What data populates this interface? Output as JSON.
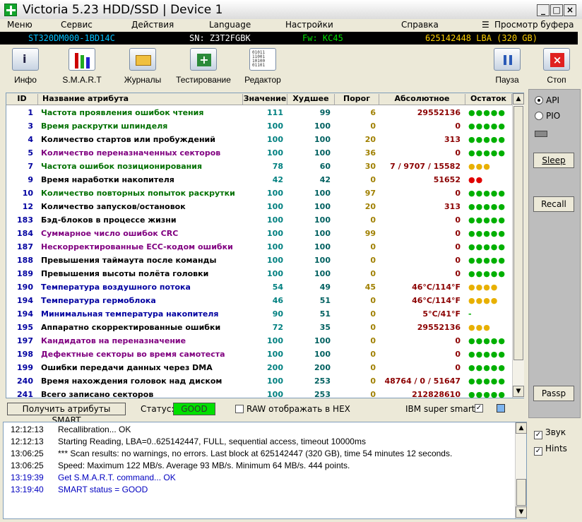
{
  "window": {
    "title": "Victoria 5.23 HDD/SSD | Device 1"
  },
  "menu": {
    "items": [
      "Меню",
      "Сервис",
      "Действия",
      "Language",
      "Настройки",
      "Справка"
    ],
    "buffer_view": "Просмотр буфера"
  },
  "device": {
    "model": "ST320DM000-1BD14C",
    "serial": "SN: Z3T2FGBK",
    "firmware": "Fw: KC45",
    "capacity": "625142448 LBA (320 GB)"
  },
  "toolbar": {
    "info": "Инфо",
    "smart": "S.M.A.R.T",
    "logs": "Журналы",
    "testing": "Тестирование",
    "editor": "Редактор",
    "pause": "Пауза",
    "stop": "Стоп"
  },
  "smart": {
    "columns": [
      "ID",
      "Название атрибута",
      "Значение",
      "Худшее",
      "Порог",
      "Абсолютное",
      "Остаток"
    ],
    "rows": [
      {
        "id": "1",
        "name": "Частота проявления ошибок чтения",
        "value": "111",
        "worst": "99",
        "threshold": "6",
        "raw": "29552136",
        "dots": "●●●●●",
        "name_color": "#007000",
        "dot_color": "#00b000"
      },
      {
        "id": "3",
        "name": "Время раскрутки шпинделя",
        "value": "100",
        "worst": "100",
        "threshold": "0",
        "raw": "0",
        "dots": "●●●●●",
        "name_color": "#007000",
        "dot_color": "#00b000"
      },
      {
        "id": "4",
        "name": "Количество стартов или пробуждений",
        "value": "100",
        "worst": "100",
        "threshold": "20",
        "raw": "313",
        "dots": "●●●●●",
        "name_color": "#000000",
        "dot_color": "#00b000"
      },
      {
        "id": "5",
        "name": "Количество переназначенных секторов",
        "value": "100",
        "worst": "100",
        "threshold": "36",
        "raw": "0",
        "dots": "●●●●●",
        "name_color": "#800080",
        "dot_color": "#00b000"
      },
      {
        "id": "7",
        "name": "Частота ошибок позиционирования",
        "value": "78",
        "worst": "60",
        "threshold": "30",
        "raw": "7 / 9707 / 15582",
        "dots": "●●●",
        "name_color": "#007000",
        "dot_color": "#e8b000"
      },
      {
        "id": "9",
        "name": "Время наработки накопителя",
        "value": "42",
        "worst": "42",
        "threshold": "0",
        "raw": "51652",
        "dots": "●●",
        "name_color": "#000000",
        "dot_color": "#e00000"
      },
      {
        "id": "10",
        "name": "Количество повторных попыток раскрутки",
        "value": "100",
        "worst": "100",
        "threshold": "97",
        "raw": "0",
        "dots": "●●●●●",
        "name_color": "#007000",
        "dot_color": "#00b000"
      },
      {
        "id": "12",
        "name": "Количество запусков/остановок",
        "value": "100",
        "worst": "100",
        "threshold": "20",
        "raw": "313",
        "dots": "●●●●●",
        "name_color": "#000000",
        "dot_color": "#00b000"
      },
      {
        "id": "183",
        "name": "Бэд-блоков в процессе жизни",
        "value": "100",
        "worst": "100",
        "threshold": "0",
        "raw": "0",
        "dots": "●●●●●",
        "name_color": "#000000",
        "dot_color": "#00b000"
      },
      {
        "id": "184",
        "name": "Суммарное число ошибок CRC",
        "value": "100",
        "worst": "100",
        "threshold": "99",
        "raw": "0",
        "dots": "●●●●●",
        "name_color": "#800080",
        "dot_color": "#00b000"
      },
      {
        "id": "187",
        "name": "Нескорректированные ECC-кодом ошибки",
        "value": "100",
        "worst": "100",
        "threshold": "0",
        "raw": "0",
        "dots": "●●●●●",
        "name_color": "#800080",
        "dot_color": "#00b000"
      },
      {
        "id": "188",
        "name": "Превышения таймаута после команды",
        "value": "100",
        "worst": "100",
        "threshold": "0",
        "raw": "0",
        "dots": "●●●●●",
        "name_color": "#000000",
        "dot_color": "#00b000"
      },
      {
        "id": "189",
        "name": "Превышения высоты полёта головки",
        "value": "100",
        "worst": "100",
        "threshold": "0",
        "raw": "0",
        "dots": "●●●●●",
        "name_color": "#000000",
        "dot_color": "#00b000"
      },
      {
        "id": "190",
        "name": "Температура воздушного потока",
        "value": "54",
        "worst": "49",
        "threshold": "45",
        "raw": "46°C/114°F",
        "dots": "●●●●",
        "name_color": "#0000a0",
        "dot_color": "#e8b000"
      },
      {
        "id": "194",
        "name": "Температура гермоблока",
        "value": "46",
        "worst": "51",
        "threshold": "0",
        "raw": "46°C/114°F",
        "dots": "●●●●",
        "name_color": "#0000a0",
        "dot_color": "#e8b000"
      },
      {
        "id": "194",
        "name": "Минимальная температура накопителя",
        "value": "90",
        "worst": "51",
        "threshold": "0",
        "raw": "5°C/41°F",
        "dots": "-",
        "name_color": "#0000a0",
        "dot_color": "#00b000"
      },
      {
        "id": "195",
        "name": "Аппаратно скорректированные ошибки",
        "value": "72",
        "worst": "35",
        "threshold": "0",
        "raw": "29552136",
        "dots": "●●●",
        "name_color": "#000000",
        "dot_color": "#e8b000"
      },
      {
        "id": "197",
        "name": "Кандидатов на переназначение",
        "value": "100",
        "worst": "100",
        "threshold": "0",
        "raw": "0",
        "dots": "●●●●●",
        "name_color": "#800080",
        "dot_color": "#00b000"
      },
      {
        "id": "198",
        "name": "Дефектные секторы во время самотеста",
        "value": "100",
        "worst": "100",
        "threshold": "0",
        "raw": "0",
        "dots": "●●●●●",
        "name_color": "#800080",
        "dot_color": "#00b000"
      },
      {
        "id": "199",
        "name": "Ошибки передачи данных через DMA",
        "value": "200",
        "worst": "200",
        "threshold": "0",
        "raw": "0",
        "dots": "●●●●●",
        "name_color": "#000000",
        "dot_color": "#00b000"
      },
      {
        "id": "240",
        "name": "Время нахождения головок над диском",
        "value": "100",
        "worst": "253",
        "threshold": "0",
        "raw": "48764 / 0 / 51647",
        "dots": "●●●●●",
        "name_color": "#000000",
        "dot_color": "#00b000"
      },
      {
        "id": "241",
        "name": "Всего записано секторов",
        "value": "100",
        "worst": "253",
        "threshold": "0",
        "raw": "212828610",
        "dots": "●●●●●",
        "name_color": "#000000",
        "dot_color": "#00b000"
      }
    ]
  },
  "status": {
    "get_smart": "Получить атрибуты SMART",
    "status_label": "Статус:",
    "status_value": "GOOD",
    "raw_hex": "RAW отображать в HEX",
    "ibm": "IBM super smart:"
  },
  "right": {
    "api": "API",
    "pio": "PIO",
    "sleep": "Sleep",
    "recall": "Recall",
    "passp": "Passp"
  },
  "log": [
    {
      "time": "12:12:13",
      "msg": "Recallibration... OK",
      "color": "#000000"
    },
    {
      "time": "12:12:13",
      "msg": "Starting Reading, LBA=0..625142447, FULL, sequential access, timeout 10000ms",
      "color": "#000000"
    },
    {
      "time": "13:06:25",
      "msg": "*** Scan results: no warnings, no errors. Last block at 625142447 (320 GB), time 54 minutes 12 seconds.",
      "color": "#000000"
    },
    {
      "time": "13:06:25",
      "msg": "Speed: Maximum 122 MB/s. Average 93 MB/s. Minimum 64 MB/s. 444 points.",
      "color": "#000000"
    },
    {
      "time": "13:19:39",
      "msg": "Get S.M.A.R.T. command... OK",
      "color": "#0000c0"
    },
    {
      "time": "13:19:40",
      "msg": "SMART status = GOOD",
      "color": "#0000c0"
    }
  ],
  "options": {
    "sound": "Звук",
    "hints": "Hints"
  },
  "colors": {
    "value_col": "#008080",
    "worst_col": "#006060",
    "threshold_col": "#a08000",
    "raw_col": "#8b0000"
  }
}
